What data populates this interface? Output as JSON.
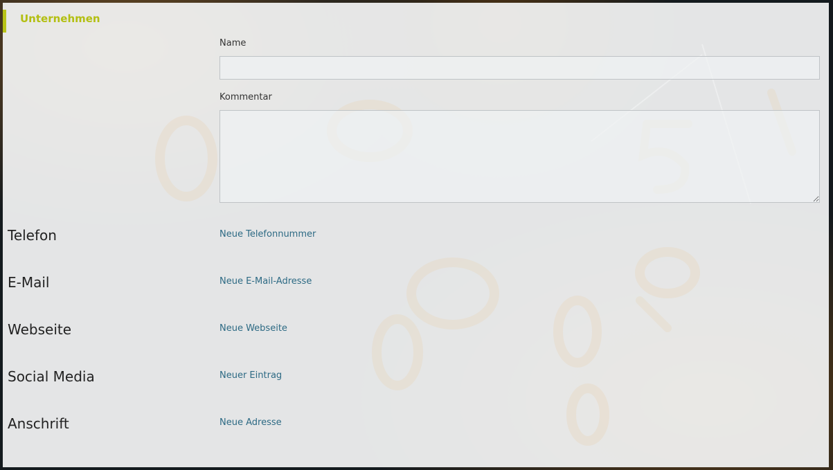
{
  "section": {
    "title": "Unternehmen",
    "accent_color": "#b9c418"
  },
  "form": {
    "name_label": "Name",
    "name_value": "",
    "comment_label": "Kommentar",
    "comment_value": ""
  },
  "rows": [
    {
      "heading": "Telefon",
      "link": "Neue Telefonnummer"
    },
    {
      "heading": "E-Mail",
      "link": "Neue E-Mail-Adresse"
    },
    {
      "heading": "Webseite",
      "link": "Neue Webseite"
    },
    {
      "heading": "Social Media",
      "link": "Neuer Eintrag"
    },
    {
      "heading": "Anschrift",
      "link": "Neue Adresse"
    }
  ],
  "colors": {
    "link": "#2d6a84",
    "heading": "#222222",
    "panel": "#f4f5f5"
  }
}
